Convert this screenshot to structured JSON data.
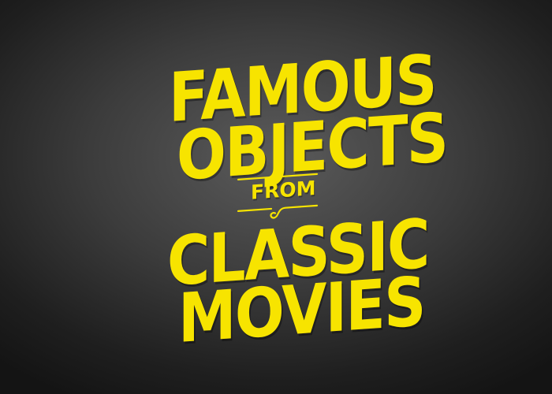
{
  "title": {
    "line1": "FAMOUS",
    "line2": "OBJECTS",
    "connector": "FROM",
    "line3": "CLASSIC",
    "line4": "MOVIES"
  },
  "colors": {
    "text": "#f7e400",
    "background_center": "#5b5b5b",
    "background_edge": "#141414"
  },
  "icons": {
    "top_ornament": "scroll-flourish-icon",
    "bottom_ornament": "scroll-flourish-icon"
  }
}
